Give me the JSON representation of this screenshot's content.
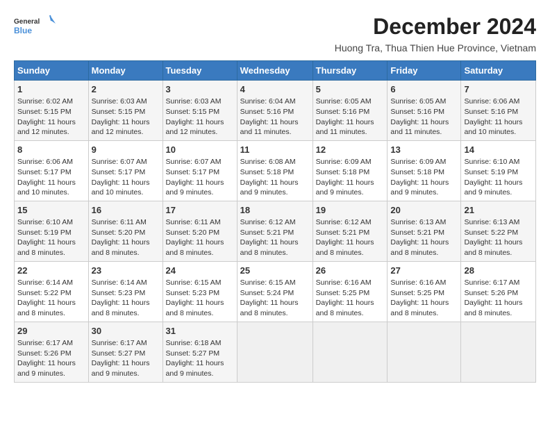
{
  "header": {
    "logo_line1": "General",
    "logo_line2": "Blue",
    "month": "December 2024",
    "location": "Huong Tra, Thua Thien Hue Province, Vietnam"
  },
  "days_of_week": [
    "Sunday",
    "Monday",
    "Tuesday",
    "Wednesday",
    "Thursday",
    "Friday",
    "Saturday"
  ],
  "weeks": [
    [
      {
        "day": "1",
        "info": "Sunrise: 6:02 AM\nSunset: 5:15 PM\nDaylight: 11 hours and 12 minutes."
      },
      {
        "day": "2",
        "info": "Sunrise: 6:03 AM\nSunset: 5:15 PM\nDaylight: 11 hours and 12 minutes."
      },
      {
        "day": "3",
        "info": "Sunrise: 6:03 AM\nSunset: 5:15 PM\nDaylight: 11 hours and 12 minutes."
      },
      {
        "day": "4",
        "info": "Sunrise: 6:04 AM\nSunset: 5:16 PM\nDaylight: 11 hours and 11 minutes."
      },
      {
        "day": "5",
        "info": "Sunrise: 6:05 AM\nSunset: 5:16 PM\nDaylight: 11 hours and 11 minutes."
      },
      {
        "day": "6",
        "info": "Sunrise: 6:05 AM\nSunset: 5:16 PM\nDaylight: 11 hours and 11 minutes."
      },
      {
        "day": "7",
        "info": "Sunrise: 6:06 AM\nSunset: 5:16 PM\nDaylight: 11 hours and 10 minutes."
      }
    ],
    [
      {
        "day": "8",
        "info": "Sunrise: 6:06 AM\nSunset: 5:17 PM\nDaylight: 11 hours and 10 minutes."
      },
      {
        "day": "9",
        "info": "Sunrise: 6:07 AM\nSunset: 5:17 PM\nDaylight: 11 hours and 10 minutes."
      },
      {
        "day": "10",
        "info": "Sunrise: 6:07 AM\nSunset: 5:17 PM\nDaylight: 11 hours and 9 minutes."
      },
      {
        "day": "11",
        "info": "Sunrise: 6:08 AM\nSunset: 5:18 PM\nDaylight: 11 hours and 9 minutes."
      },
      {
        "day": "12",
        "info": "Sunrise: 6:09 AM\nSunset: 5:18 PM\nDaylight: 11 hours and 9 minutes."
      },
      {
        "day": "13",
        "info": "Sunrise: 6:09 AM\nSunset: 5:18 PM\nDaylight: 11 hours and 9 minutes."
      },
      {
        "day": "14",
        "info": "Sunrise: 6:10 AM\nSunset: 5:19 PM\nDaylight: 11 hours and 9 minutes."
      }
    ],
    [
      {
        "day": "15",
        "info": "Sunrise: 6:10 AM\nSunset: 5:19 PM\nDaylight: 11 hours and 8 minutes."
      },
      {
        "day": "16",
        "info": "Sunrise: 6:11 AM\nSunset: 5:20 PM\nDaylight: 11 hours and 8 minutes."
      },
      {
        "day": "17",
        "info": "Sunrise: 6:11 AM\nSunset: 5:20 PM\nDaylight: 11 hours and 8 minutes."
      },
      {
        "day": "18",
        "info": "Sunrise: 6:12 AM\nSunset: 5:21 PM\nDaylight: 11 hours and 8 minutes."
      },
      {
        "day": "19",
        "info": "Sunrise: 6:12 AM\nSunset: 5:21 PM\nDaylight: 11 hours and 8 minutes."
      },
      {
        "day": "20",
        "info": "Sunrise: 6:13 AM\nSunset: 5:21 PM\nDaylight: 11 hours and 8 minutes."
      },
      {
        "day": "21",
        "info": "Sunrise: 6:13 AM\nSunset: 5:22 PM\nDaylight: 11 hours and 8 minutes."
      }
    ],
    [
      {
        "day": "22",
        "info": "Sunrise: 6:14 AM\nSunset: 5:22 PM\nDaylight: 11 hours and 8 minutes."
      },
      {
        "day": "23",
        "info": "Sunrise: 6:14 AM\nSunset: 5:23 PM\nDaylight: 11 hours and 8 minutes."
      },
      {
        "day": "24",
        "info": "Sunrise: 6:15 AM\nSunset: 5:23 PM\nDaylight: 11 hours and 8 minutes."
      },
      {
        "day": "25",
        "info": "Sunrise: 6:15 AM\nSunset: 5:24 PM\nDaylight: 11 hours and 8 minutes."
      },
      {
        "day": "26",
        "info": "Sunrise: 6:16 AM\nSunset: 5:25 PM\nDaylight: 11 hours and 8 minutes."
      },
      {
        "day": "27",
        "info": "Sunrise: 6:16 AM\nSunset: 5:25 PM\nDaylight: 11 hours and 8 minutes."
      },
      {
        "day": "28",
        "info": "Sunrise: 6:17 AM\nSunset: 5:26 PM\nDaylight: 11 hours and 8 minutes."
      }
    ],
    [
      {
        "day": "29",
        "info": "Sunrise: 6:17 AM\nSunset: 5:26 PM\nDaylight: 11 hours and 9 minutes."
      },
      {
        "day": "30",
        "info": "Sunrise: 6:17 AM\nSunset: 5:27 PM\nDaylight: 11 hours and 9 minutes."
      },
      {
        "day": "31",
        "info": "Sunrise: 6:18 AM\nSunset: 5:27 PM\nDaylight: 11 hours and 9 minutes."
      },
      {
        "day": "",
        "info": ""
      },
      {
        "day": "",
        "info": ""
      },
      {
        "day": "",
        "info": ""
      },
      {
        "day": "",
        "info": ""
      }
    ]
  ]
}
